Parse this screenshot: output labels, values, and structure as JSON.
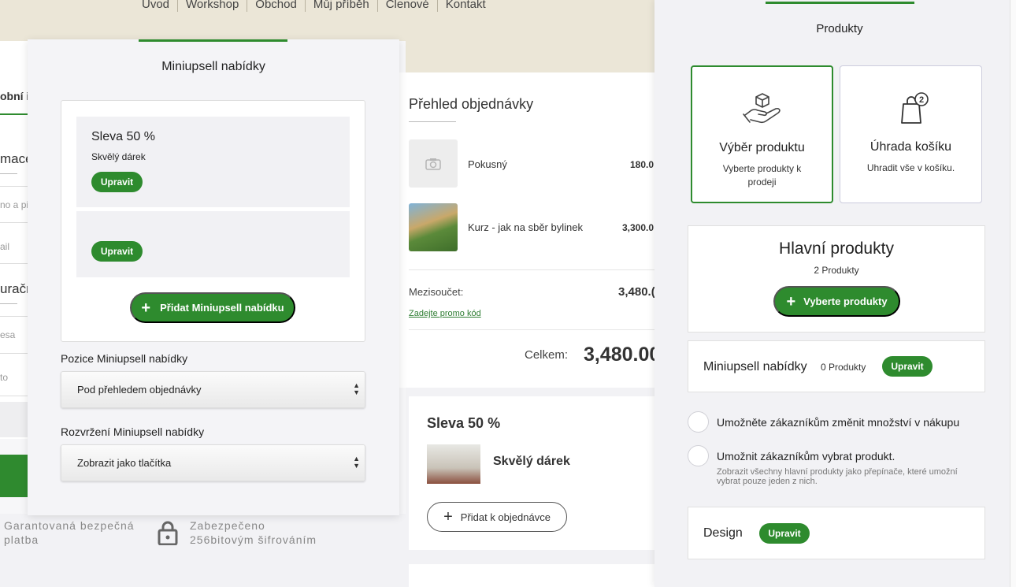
{
  "background": {
    "nav": [
      "Úvod",
      "Workshop",
      "Obchod",
      "Můj příběh",
      "Členové",
      "Kontakt"
    ],
    "left_fragments": [
      "obní i",
      "mace",
      "no a pi",
      "ail",
      "uračn",
      "esa",
      "to"
    ],
    "footer": {
      "secure_payment": "Garantovaná bezpečná platba",
      "encryption": "Zabezpečeno 256bitovým šifrováním"
    },
    "order": {
      "title": "Přehled objednávky",
      "items": [
        {
          "name": "Pokusný",
          "price": "180.0",
          "image": "camera-icon"
        },
        {
          "name": "Kurz - jak na sběr bylinek",
          "price": "3,300.0",
          "image": "photo"
        }
      ],
      "subtotal_label": "Mezisoučet:",
      "subtotal_value": "3,480.(",
      "promo": "Zadejte promo kód",
      "total_label": "Celkem:",
      "total_value": "3,480.00"
    },
    "upsell_card": {
      "title": "Sleva 50 %",
      "product": "Skvělý dárek",
      "button": "Přidat k objednávce"
    }
  },
  "popup": {
    "title": "Miniupsell nabídky",
    "items": [
      {
        "name": "Sleva 50 %",
        "sub": "Skvělý dárek",
        "edit": "Upravit"
      },
      {
        "name": "",
        "sub": "",
        "edit": "Upravit"
      }
    ],
    "add_button": "Přidat Miniupsell nabídku",
    "position_label": "Pozice Miniupsell nabídky",
    "position_value": "Pod přehledem objednávky",
    "layout_label": "Rozvržení Miniupsell nabídky",
    "layout_value": "Zobrazit jako tlačítka"
  },
  "panel": {
    "title": "Produkty",
    "types": [
      {
        "title": "Výběr produktu",
        "desc": "Vyberte produkty k prodeji",
        "icon": "hand-box-icon",
        "selected": true
      },
      {
        "title": "Úhrada košíku",
        "desc": "Uhradit vše v košíku.",
        "icon": "bag-icon",
        "badge": "2",
        "selected": false
      }
    ],
    "main_products": {
      "title": "Hlavní produkty",
      "count": "2 Produkty",
      "button": "Vyberte produkty"
    },
    "miniupsell": {
      "label": "Miniupsell nabídky",
      "count": "0 Produkty",
      "button": "Upravit"
    },
    "options": [
      {
        "label": "Umožněte zákazníkům změnit množství v nákupu",
        "help": ""
      },
      {
        "label": "Umožnit zákazníkům vybrat produkt.",
        "help": "Zobrazit všechny hlavní produkty jako přepínače, které umožní vybrat pouze jeden z nich."
      }
    ],
    "design": {
      "label": "Design",
      "button": "Upravit"
    }
  },
  "colors": {
    "accent": "#2e8b2e",
    "nav_bg": "#ebe6d7"
  }
}
